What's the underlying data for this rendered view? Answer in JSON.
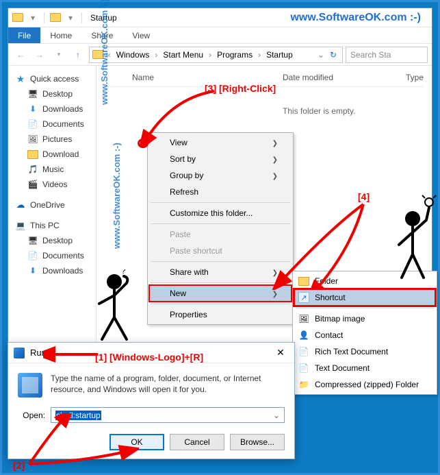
{
  "toplink": "www.SoftwareOK.com :-)",
  "watermark": "www.SoftwareOK.com :-)",
  "explorer": {
    "title": "Startup",
    "menu": {
      "file": "File",
      "home": "Home",
      "share": "Share",
      "view": "View"
    },
    "breadcrumbs": [
      "Windows",
      "Start Menu",
      "Programs",
      "Startup"
    ],
    "search_placeholder": "Search Sta",
    "columns": {
      "name": "Name",
      "modified": "Date modified",
      "type": "Type"
    },
    "empty_text": "This folder is empty."
  },
  "sidebar": {
    "quick_access": "Quick access",
    "items1": [
      "Desktop",
      "Downloads",
      "Documents",
      "Pictures",
      "Download",
      "Music",
      "Videos"
    ],
    "onedrive": "OneDrive",
    "thispc": "This PC",
    "items2": [
      "Desktop",
      "Documents",
      "Downloads"
    ]
  },
  "context_menu": {
    "view": "View",
    "sort": "Sort by",
    "group": "Group by",
    "refresh": "Refresh",
    "customize": "Customize this folder...",
    "paste": "Paste",
    "paste_shortcut": "Paste shortcut",
    "share": "Share with",
    "new": "New",
    "properties": "Properties"
  },
  "submenu": {
    "folder": "Folder",
    "shortcut": "Shortcut",
    "bitmap": "Bitmap image",
    "contact": "Contact",
    "rtf": "Rich Text Document",
    "txt": "Text Document",
    "zip": "Compressed (zipped) Folder"
  },
  "run": {
    "title": "Run",
    "desc": "Type the name of a program, folder, document, or Internet resource, and Windows will open it for you.",
    "open_label": "Open:",
    "value": "shell:startup",
    "ok": "OK",
    "cancel": "Cancel",
    "browse": "Browse..."
  },
  "annotations": {
    "a1": "[1] [Windows-Logo]+[R]",
    "a2": "[2]",
    "a3": "[3]  [Right-Click]",
    "a4": "[4]"
  }
}
